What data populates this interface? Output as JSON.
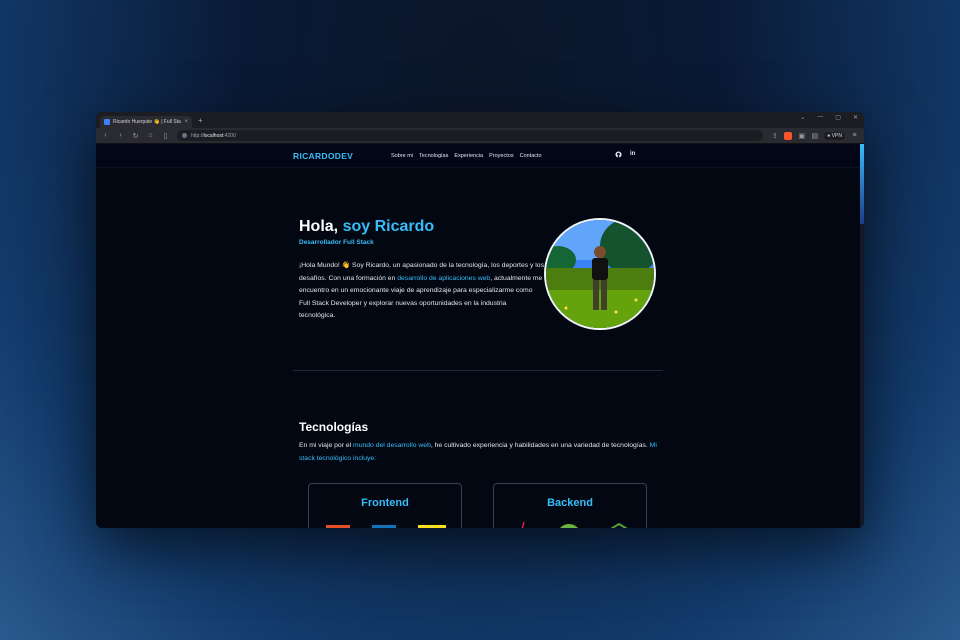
{
  "browser": {
    "tab_title": "Ricardo Huerpate 👋 | Full Stac",
    "tab_close": "×",
    "new_tab": "+",
    "url_prefix": "http://",
    "url_host": "localhost",
    "url_suffix": ":4200",
    "vpn_label": "● VPN",
    "window_controls": [
      "⌄",
      "—",
      "▢",
      "✕"
    ]
  },
  "nav": {
    "logo": "RICARDODEV",
    "links": [
      "Sobre mi",
      "Tecnologías",
      "Experiencia",
      "Proyectos",
      "Contacto"
    ],
    "social": [
      "github-icon",
      "linkedin-icon"
    ],
    "linkedin_label": "in"
  },
  "hero": {
    "greeting": "Hola,",
    "name": "soy Ricardo",
    "role": "Desarrollador Full Stack",
    "bio_part1": "¡Hola Mundo! 👋 Soy Ricardo, un apasionado de la tecnología, los deportes y los desafíos. Con una formación en ",
    "bio_link": "desarrollo de aplicaciones web",
    "bio_part2": ", actualmente me encuentro en un emocionante viaje de aprendizaje para especializarme como Full Stack Developer y explorar nuevas oportunidades en la industria tecnológica."
  },
  "tech": {
    "title": "Tecnologías",
    "intro_part1": "En mi viaje por el ",
    "intro_link1": "mundo del desarrollo web",
    "intro_part2": ", he cultivado experiencia y habilidades en una variedad de tecnologías. ",
    "intro_link2": "Mi stack tecnológico incluye:",
    "cards": [
      {
        "title": "Frontend"
      },
      {
        "title": "Backend"
      }
    ]
  },
  "colors": {
    "accent": "#38bdf8",
    "background": "#030712"
  }
}
